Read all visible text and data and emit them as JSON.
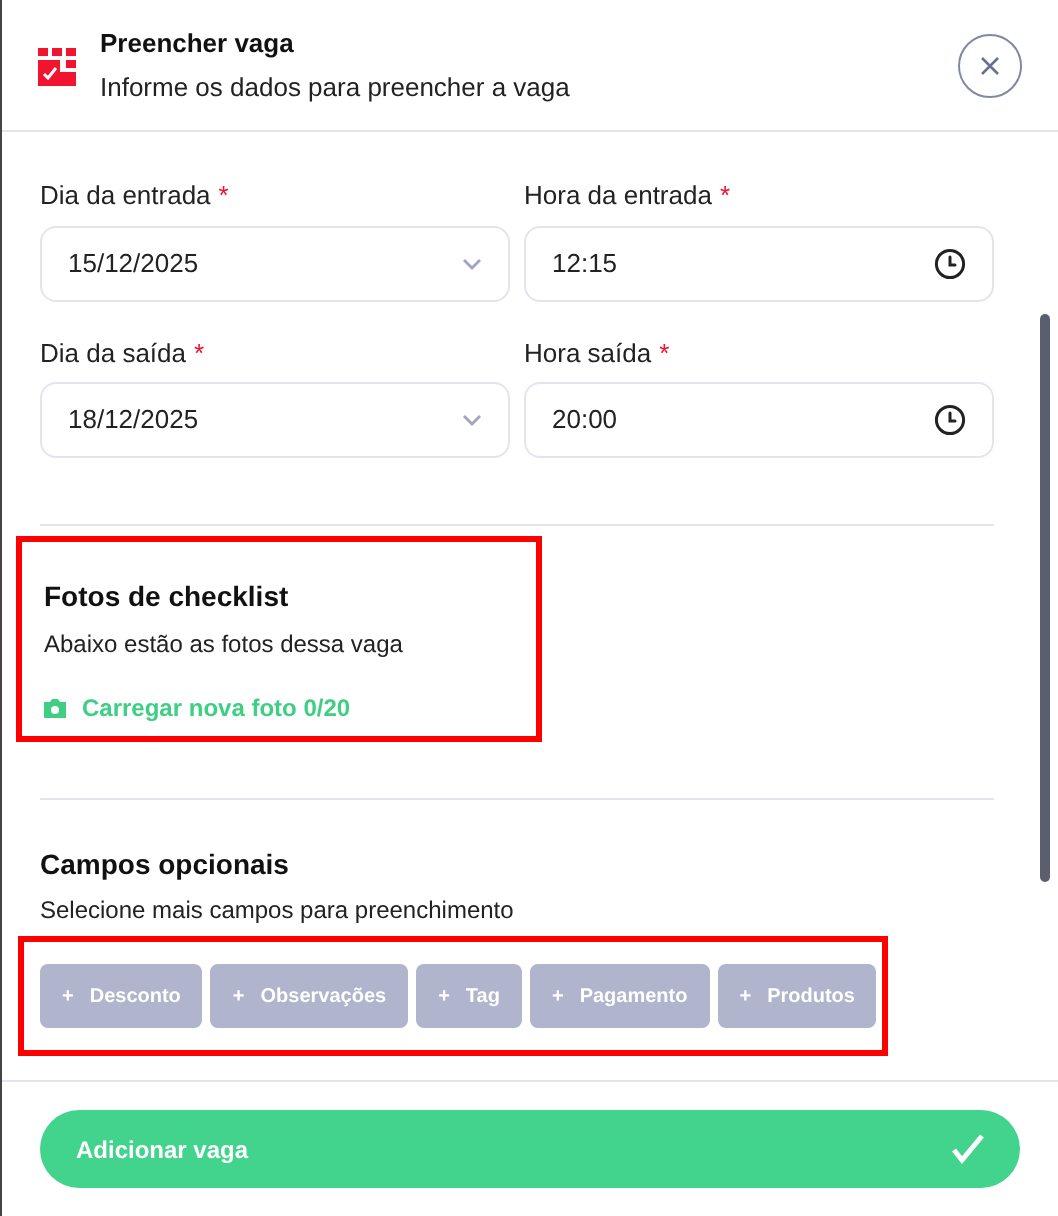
{
  "header": {
    "title": "Preencher vaga",
    "subtitle": "Informe os dados para preencher a vaga"
  },
  "fields": [
    {
      "label": "Dia da entrada",
      "required": true,
      "value": "15/12/2025",
      "kind": "date"
    },
    {
      "label": "Hora da entrada",
      "required": true,
      "value": "12:15",
      "kind": "time"
    },
    {
      "label": "Dia da saída",
      "required": true,
      "value": "18/12/2025",
      "kind": "date"
    },
    {
      "label": "Hora saída",
      "required": true,
      "value": "20:00",
      "kind": "time"
    }
  ],
  "required_mark": "*",
  "photos": {
    "title": "Fotos de checklist",
    "subtitle": "Abaixo estão as fotos dessa vaga",
    "upload": "Carregar nova foto 0/20",
    "highlighted": true
  },
  "optional": {
    "title": "Campos opcionais",
    "subtitle": "Selecione mais campos para preenchimento",
    "highlighted": true,
    "buttons": [
      {
        "label": "Desconto",
        "icon": "+"
      },
      {
        "label": "Observações",
        "icon": "+"
      },
      {
        "label": "Tag",
        "icon": "+"
      },
      {
        "label": "Pagamento",
        "icon": "+"
      },
      {
        "label": "Produtos",
        "icon": "+"
      }
    ]
  },
  "submit": {
    "label": "Adicionar vaga"
  }
}
